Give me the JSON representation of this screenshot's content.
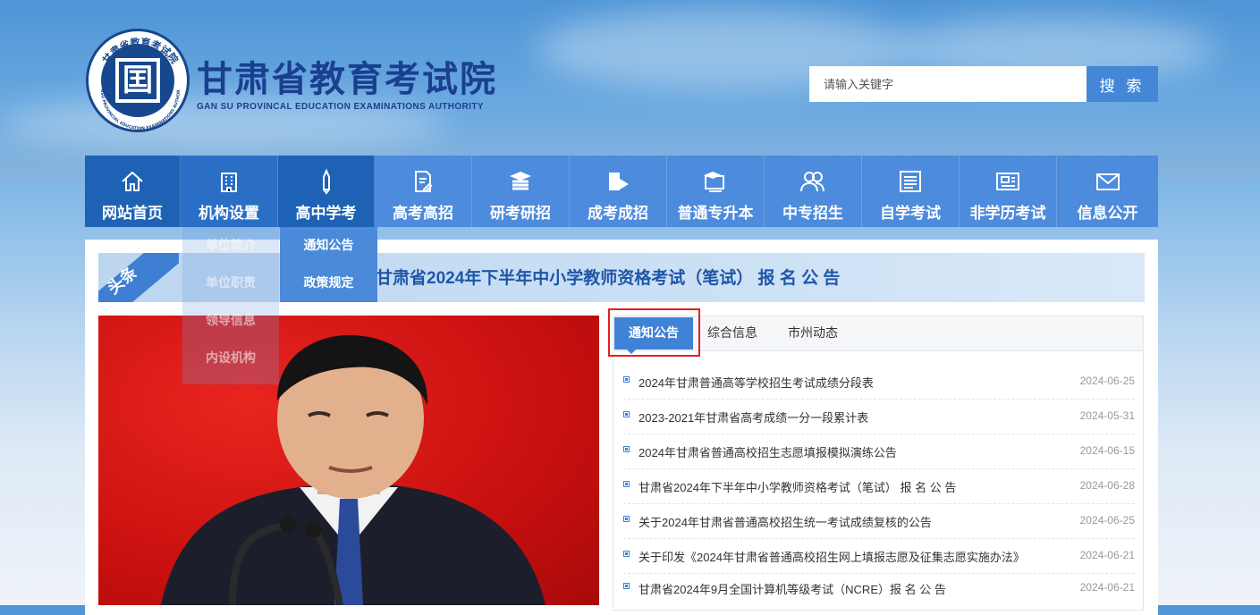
{
  "site": {
    "title": "甘肃省教育考试院",
    "subtitle": "GAN SU PROVINCAL EDUCATION EXAMINATIONS AUTHORITY",
    "seal_ring_text": "甘肃省教育考试院",
    "seal_ring_text_en": "GANSU PROVINCIAL EDUCATION EXAMINATIONS AUTHORITY",
    "seal_glyph": "囯"
  },
  "search": {
    "placeholder": "请输入关键字",
    "button": "搜 索"
  },
  "nav": [
    {
      "label": "网站首页",
      "icon": "home-icon"
    },
    {
      "label": "机构设置",
      "icon": "building-icon"
    },
    {
      "label": "高中学考",
      "icon": "pen-icon"
    },
    {
      "label": "高考高招",
      "icon": "document-edit-icon"
    },
    {
      "label": "研考研招",
      "icon": "books-icon"
    },
    {
      "label": "成考成招",
      "icon": "book-arrow-icon"
    },
    {
      "label": "普通专升本",
      "icon": "graduation-board-icon"
    },
    {
      "label": "中专招生",
      "icon": "users-icon"
    },
    {
      "label": "自学考试",
      "icon": "newspaper-icon"
    },
    {
      "label": "非学历考试",
      "icon": "certificate-icon"
    },
    {
      "label": "信息公开",
      "icon": "mail-icon"
    }
  ],
  "dropdown_org": [
    "单位简介",
    "单位职责",
    "领导信息",
    "内设机构"
  ],
  "dropdown_gaozhong": [
    "通知公告",
    "政策规定"
  ],
  "headline": {
    "tag": "头条",
    "text": "甘肃省2024年下半年中小学教师资格考试（笔试） 报 名 公 告"
  },
  "tabs": [
    "通知公告",
    "综合信息",
    "市州动态"
  ],
  "news": [
    {
      "title": "2024年甘肃普通高等学校招生考试成绩分段表",
      "date": "2024-06-25"
    },
    {
      "title": "2023-2021年甘肃省高考成绩一分一段累计表",
      "date": "2024-05-31"
    },
    {
      "title": "2024年甘肃省普通高校招生志愿填报模拟演练公告",
      "date": "2024-06-15"
    },
    {
      "title": "甘肃省2024年下半年中小学教师资格考试（笔试） 报 名 公 告",
      "date": "2024-06-28"
    },
    {
      "title": "关于2024年甘肃省普通高校招生统一考试成绩复核的公告",
      "date": "2024-06-25"
    },
    {
      "title": "关于印发《2024年甘肃省普通高校招生网上填报志愿及征集志愿实施办法》",
      "date": "2024-06-21"
    },
    {
      "title": "甘肃省2024年9月全国计算机等级考试（NCRE）报 名 公 告",
      "date": "2024-06-21"
    }
  ],
  "colors": {
    "brand": "#1b3f8f",
    "nav": "#4d8bdc",
    "nav_home": "#1e62b6",
    "accent": "#3f82d6",
    "highlight": "#e02020"
  }
}
